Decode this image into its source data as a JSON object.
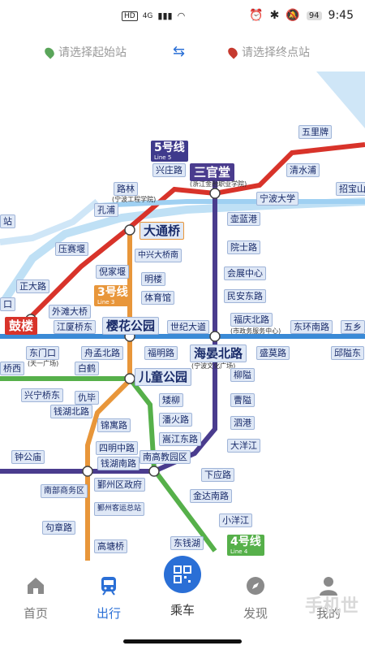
{
  "status_bar": {
    "left_badges": [
      "HD",
      "4G"
    ],
    "battery": "94",
    "time": "9:45"
  },
  "route": {
    "start_placeholder": "请选择起始站",
    "end_placeholder": "请选择终点站",
    "start_pin_color": "#5aa55a",
    "end_pin_color": "#c63a2f",
    "swap_icon": "swap-arrows-icon"
  },
  "map": {
    "line_badges": [
      {
        "label": "5号线",
        "en": "Line 5",
        "color": "#3f3a8c"
      },
      {
        "label": "3号线",
        "en": "Line 3",
        "color": "#e8963a"
      },
      {
        "label": "4号线",
        "en": "Line 4",
        "color": "#56b04a"
      }
    ],
    "stations": [
      {
        "name": "五里牌"
      },
      {
        "name": "清水浦"
      },
      {
        "name": "招宝山"
      },
      {
        "name": "兴庄路"
      },
      {
        "name": "三官堂"
      },
      {
        "name": "宁波大学"
      },
      {
        "name": "路林"
      },
      {
        "name": "孔浦"
      },
      {
        "name": "大通桥"
      },
      {
        "name": "壶蓝港"
      },
      {
        "name": "压赛堰"
      },
      {
        "name": "倪家堰"
      },
      {
        "name": "中兴大桥南"
      },
      {
        "name": "明楼"
      },
      {
        "name": "体育馆"
      },
      {
        "name": "院士路"
      },
      {
        "name": "会展中心"
      },
      {
        "name": "民安东路"
      },
      {
        "name": "正大路"
      },
      {
        "name": "外滩大桥"
      },
      {
        "name": "鼓楼"
      },
      {
        "name": "江厦桥东"
      },
      {
        "name": "樱花公园"
      },
      {
        "name": "世纪大道"
      },
      {
        "name": "福庆北路"
      },
      {
        "name": "东环南路"
      },
      {
        "name": "东门口"
      },
      {
        "name": "舟孟北路"
      },
      {
        "name": "福明路"
      },
      {
        "name": "海晏北路"
      },
      {
        "name": "盛莫路"
      },
      {
        "name": "邱隘东"
      },
      {
        "name": "白鹤"
      },
      {
        "name": "儿童公园"
      },
      {
        "name": "柳隘"
      },
      {
        "name": "兴宁桥东"
      },
      {
        "name": "仇毕"
      },
      {
        "name": "钱湖北路"
      },
      {
        "name": "矮柳"
      },
      {
        "name": "曹隘"
      },
      {
        "name": "锦寓路"
      },
      {
        "name": "潘火路"
      },
      {
        "name": "泗港"
      },
      {
        "name": "四明中路"
      },
      {
        "name": "嵩江东路"
      },
      {
        "name": "大洋江"
      },
      {
        "name": "钟公庙"
      },
      {
        "name": "钱湖南路"
      },
      {
        "name": "南高教园区"
      },
      {
        "name": "鄞州区政府"
      },
      {
        "name": "下应路"
      },
      {
        "name": "南部商务区"
      },
      {
        "name": "金达南路"
      },
      {
        "name": "鄞州客运总站"
      },
      {
        "name": "小洋江"
      },
      {
        "name": "句章路"
      },
      {
        "name": "东钱湖"
      },
      {
        "name": "高塘桥"
      },
      {
        "name": "五乡"
      },
      {
        "name": "站"
      },
      {
        "name": "口"
      },
      {
        "name": "桥西"
      }
    ],
    "sub_labels": {
      "ningbo_engineering": "(宁波工程学院)",
      "ningbo_finance": "(浙江金融职业学院)",
      "tianyi_square": "(天一广场)",
      "admin_center": "(市政务服务中心)",
      "culture_square": "(宁波文化广场)"
    }
  },
  "tabs": [
    {
      "label": "首页",
      "icon": "home-icon"
    },
    {
      "label": "出行",
      "icon": "train-icon"
    },
    {
      "label": "乘车",
      "icon": "qr-code-icon"
    },
    {
      "label": "发现",
      "icon": "compass-icon"
    },
    {
      "label": "我的",
      "icon": "user-icon"
    }
  ],
  "watermark": "手机世"
}
